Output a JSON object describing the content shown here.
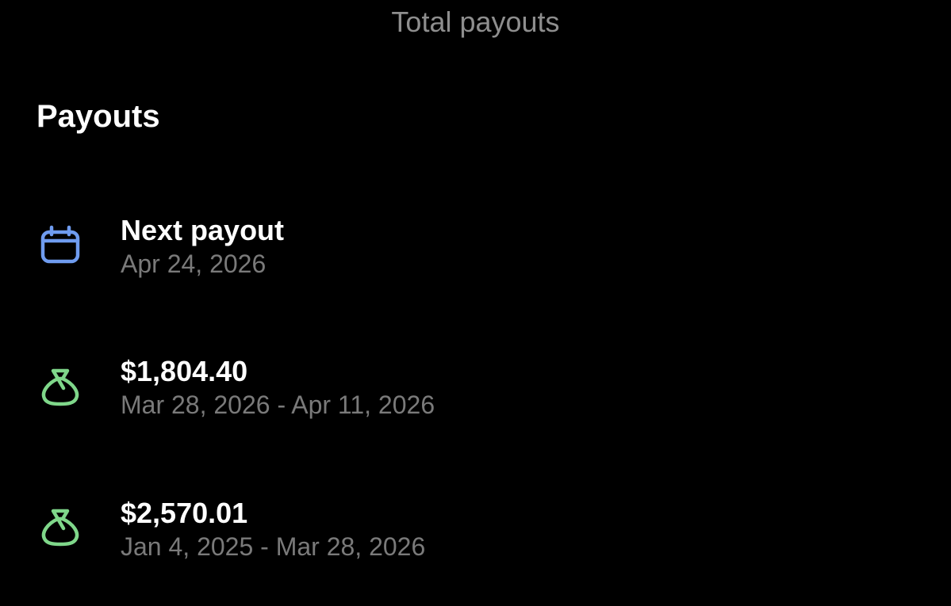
{
  "header": {
    "top_label": "Total payouts"
  },
  "section": {
    "title": "Payouts"
  },
  "colors": {
    "calendar_icon": "#6f9cf0",
    "money_bag_icon": "#7fd78a",
    "secondary_text": "#7a7a7a"
  },
  "payouts": [
    {
      "icon": "calendar-icon",
      "title": "Next payout",
      "subtitle": "Apr 24, 2026"
    },
    {
      "icon": "money-bag-icon",
      "title": "$1,804.40",
      "subtitle": "Mar 28, 2026 - Apr 11, 2026"
    },
    {
      "icon": "money-bag-icon",
      "title": "$2,570.01",
      "subtitle": "Jan 4, 2025 - Mar 28, 2026"
    }
  ]
}
